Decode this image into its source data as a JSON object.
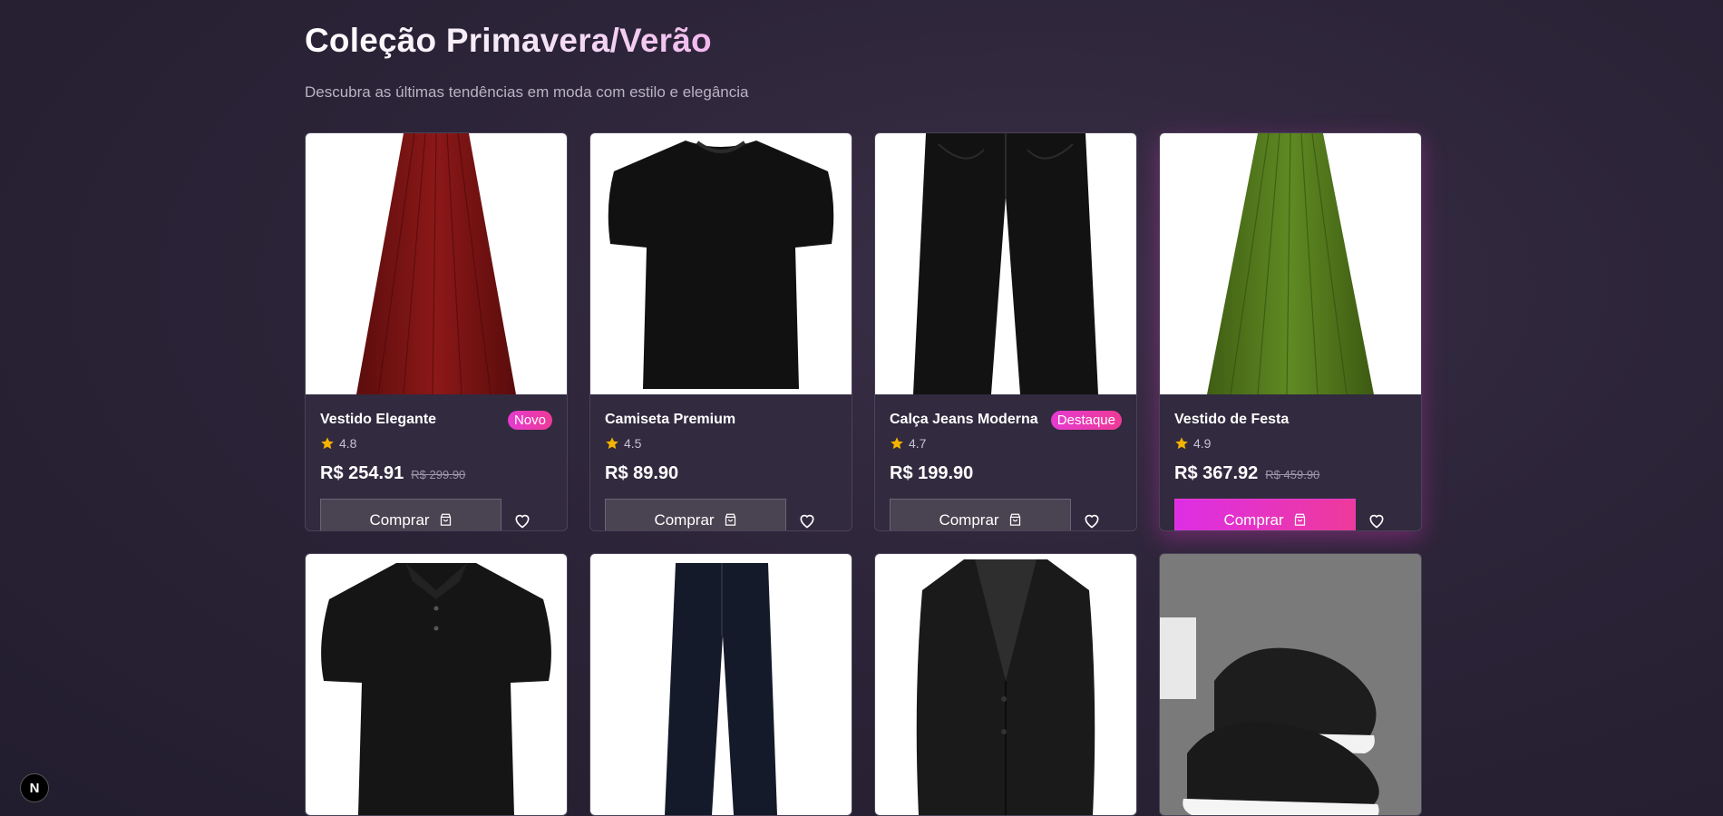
{
  "header": {
    "title": "Coleção Primavera/Verão",
    "subtitle": "Descubra as últimas tendências em moda com estilo e elegância"
  },
  "products": [
    {
      "name": "Vestido Elegante",
      "badge": "Novo",
      "rating": "4.8",
      "price": "R$ 254.91",
      "old_price": "R$ 299.90",
      "buy_label": "Comprar",
      "image": "red-skirt"
    },
    {
      "name": "Camiseta Premium",
      "badge": "",
      "rating": "4.5",
      "price": "R$ 89.90",
      "old_price": "",
      "buy_label": "Comprar",
      "image": "black-tshirt"
    },
    {
      "name": "Calça Jeans Moderna",
      "badge": "Destaque",
      "rating": "4.7",
      "price": "R$ 199.90",
      "old_price": "",
      "buy_label": "Comprar",
      "image": "black-jeans"
    },
    {
      "name": "Vestido de Festa",
      "badge": "",
      "rating": "4.9",
      "price": "R$ 367.92",
      "old_price": "R$ 459.90",
      "buy_label": "Comprar",
      "image": "green-skirt"
    },
    {
      "name": "",
      "badge": "",
      "rating": "",
      "price": "",
      "old_price": "",
      "buy_label": "",
      "image": "black-polo"
    },
    {
      "name": "",
      "badge": "",
      "rating": "",
      "price": "",
      "old_price": "",
      "buy_label": "",
      "image": "navy-trousers"
    },
    {
      "name": "",
      "badge": "",
      "rating": "",
      "price": "",
      "old_price": "",
      "buy_label": "",
      "image": "black-blazer"
    },
    {
      "name": "",
      "badge": "",
      "rating": "",
      "price": "",
      "old_price": "",
      "buy_label": "",
      "image": "black-sneakers"
    }
  ],
  "colors": {
    "accent": "#e53bd0",
    "star": "#f5b301"
  },
  "dev_badge": "N"
}
